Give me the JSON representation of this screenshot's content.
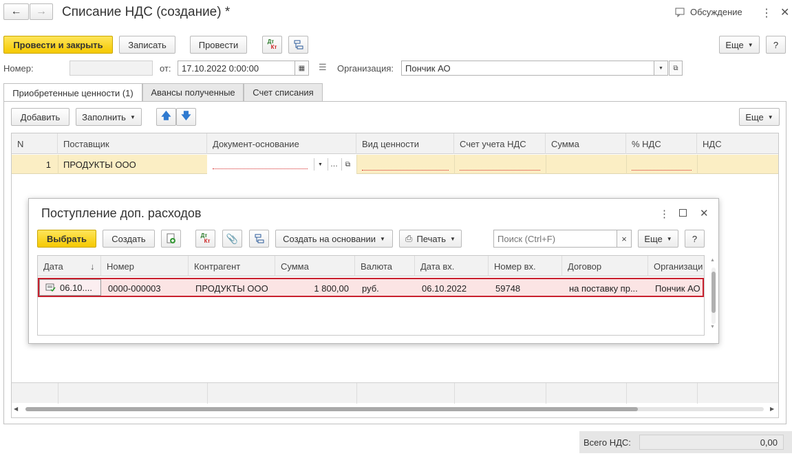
{
  "window": {
    "title": "Списание НДС (создание) *",
    "discussion_label": "Обсуждение"
  },
  "toolbar": {
    "post_close": "Провести и закрыть",
    "write": "Записать",
    "post": "Провести",
    "dtkt_top": "Дт",
    "dtkt_bottom": "Кт",
    "more": "Еще",
    "help": "?"
  },
  "header": {
    "number_label": "Номер:",
    "number_value": "",
    "date_label": "от:",
    "date_value": "17.10.2022  0:00:00",
    "org_label": "Организация:",
    "org_value": "Пончик АО"
  },
  "tabs": [
    {
      "label": "Приобретенные ценности (1)",
      "active": true
    },
    {
      "label": "Авансы полученные",
      "active": false
    },
    {
      "label": "Счет списания",
      "active": false
    }
  ],
  "table_toolbar": {
    "add": "Добавить",
    "fill": "Заполнить",
    "more": "Еще"
  },
  "table": {
    "columns": [
      "N",
      "Поставщик",
      "Документ-основание",
      "Вид ценности",
      "Счет учета НДС",
      "Сумма",
      "% НДС",
      "НДС"
    ],
    "rows": [
      {
        "n": "1",
        "supplier": "ПРОДУКТЫ ООО",
        "doc": "",
        "kind": "",
        "account": "",
        "sum": "",
        "pct": "",
        "vat": ""
      }
    ]
  },
  "dialog": {
    "title": "Поступление доп. расходов",
    "select": "Выбрать",
    "create": "Создать",
    "create_based": "Создать на основании",
    "print": "Печать",
    "search_placeholder": "Поиск (Ctrl+F)",
    "clear": "×",
    "more": "Еще",
    "help": "?",
    "sort_arrow": "↓",
    "columns": [
      "Дата",
      "Номер",
      "Контрагент",
      "Сумма",
      "Валюта",
      "Дата вх.",
      "Номер вх.",
      "Договор",
      "Организаци"
    ],
    "rows": [
      {
        "date": "06.10....",
        "number": "0000-000003",
        "counterparty": "ПРОДУКТЫ ООО",
        "sum": "1 800,00",
        "currency": "руб.",
        "in_date": "06.10.2022",
        "in_number": "59748",
        "contract": "на поставку пр...",
        "org": "Пончик АО"
      }
    ]
  },
  "footer": {
    "total_vat_label": "Всего НДС:",
    "total_vat_value": "0,00"
  },
  "colors": {
    "accent_yellow": "#f5c900",
    "selected_row": "#fbeec4",
    "highlight_border": "#c8202e"
  }
}
